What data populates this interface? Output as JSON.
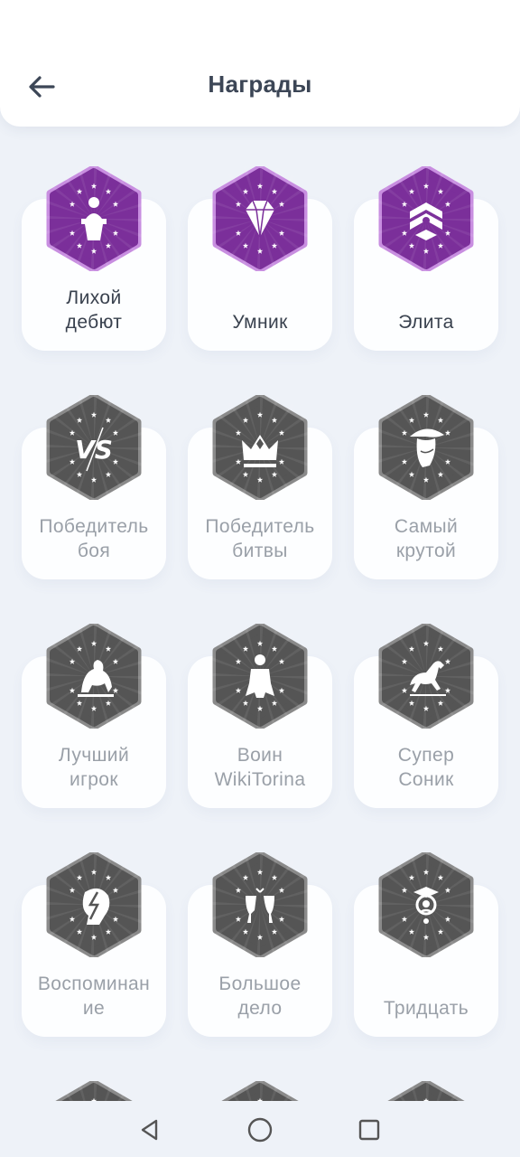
{
  "header": {
    "title": "Награды",
    "back_icon": "arrow-left-icon"
  },
  "colors": {
    "unlocked": "#7b2f9a",
    "locked": "#555555",
    "background": "#eef2f8"
  },
  "awards": [
    {
      "line1": "Лихой",
      "line2": "дебют",
      "icon": "speaker-podium-icon",
      "unlocked": true
    },
    {
      "line1": "",
      "line2": "Умник",
      "icon": "diamond-icon",
      "unlocked": true
    },
    {
      "line1": "",
      "line2": "Элита",
      "icon": "elite-emblem-icon",
      "unlocked": true
    },
    {
      "line1": "Победитель",
      "line2": "боя",
      "icon": "vs-icon",
      "unlocked": false
    },
    {
      "line1": "Победитель",
      "line2": "битвы",
      "icon": "crown-icon",
      "unlocked": false
    },
    {
      "line1": "Самый",
      "line2": "крутой",
      "icon": "cowboy-icon",
      "unlocked": false
    },
    {
      "line1": "Лучший",
      "line2": "игрок",
      "icon": "lion-icon",
      "unlocked": false
    },
    {
      "line1": "Воин",
      "line2": "WikiTorina",
      "icon": "hero-icon",
      "unlocked": false
    },
    {
      "line1": "Супер",
      "line2": "Соник",
      "icon": "horse-icon",
      "unlocked": false
    },
    {
      "line1": "Воспоминан",
      "line2": "ие",
      "icon": "lightning-head-icon",
      "unlocked": false
    },
    {
      "line1": "Большое",
      "line2": "дело",
      "icon": "wine-glasses-icon",
      "unlocked": false
    },
    {
      "line1": "",
      "line2": "Тридцать",
      "icon": "graduate-icon",
      "unlocked": false
    }
  ],
  "nav": {
    "back": "triangle-back-icon",
    "home": "circle-home-icon",
    "recent": "square-recents-icon"
  }
}
